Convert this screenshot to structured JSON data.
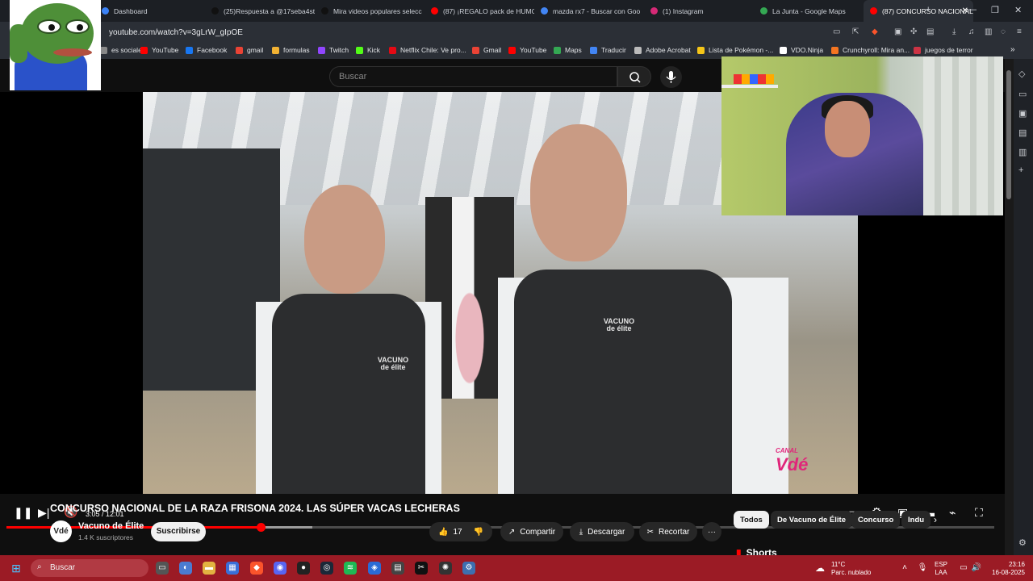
{
  "browser": {
    "tabs": [
      {
        "label": "Dashboard",
        "color": "#3b82f6"
      },
      {
        "label": "(25)Respuesta a @17seba4st",
        "color": "#111111"
      },
      {
        "label": "Mira videos populares selecc",
        "color": "#111111"
      },
      {
        "label": "(87) ¡REGALO pack de HUMO",
        "color": "#ff0000"
      },
      {
        "label": "mazda rx7 - Buscar con Goo",
        "color": "#4285f4"
      },
      {
        "label": "(1) Instagram",
        "color": "#d62976"
      },
      {
        "label": "La Junta - Google Maps",
        "color": "#34a853"
      },
      {
        "label": "(87) CONCURSO NACIONAL",
        "color": "#ff0000",
        "active": true
      }
    ],
    "new_tab": "+",
    "window_controls": {
      "minimize": "—",
      "maximize": "❐",
      "close": "✕"
    },
    "url": "youtube.com/watch?v=3gLrW_gIpOE",
    "bookmarks": [
      {
        "label": "es sociales",
        "color": "#888888"
      },
      {
        "label": "YouTube",
        "color": "#ff0000"
      },
      {
        "label": "Facebook",
        "color": "#1877f2"
      },
      {
        "label": "gmail",
        "color": "#ea4335"
      },
      {
        "label": "formulas",
        "color": "#f2b233"
      },
      {
        "label": "Twitch",
        "color": "#9146ff"
      },
      {
        "label": "Kick",
        "color": "#53fc18"
      },
      {
        "label": "Netflix Chile: Ve pro...",
        "color": "#e50914"
      },
      {
        "label": "Gmail",
        "color": "#ea4335"
      },
      {
        "label": "YouTube",
        "color": "#ff0000"
      },
      {
        "label": "Maps",
        "color": "#34a853"
      },
      {
        "label": "Traducir",
        "color": "#4285f4"
      },
      {
        "label": "Adobe Acrobat",
        "color": "#bbbbbb"
      },
      {
        "label": "Lista de Pokémon -...",
        "color": "#f5c518"
      },
      {
        "label": "VDO.Ninja",
        "color": "#ffffff"
      },
      {
        "label": "Crunchyroll: Mira an...",
        "color": "#f47521"
      },
      {
        "label": "juegos de terror",
        "color": "#cc3344"
      }
    ]
  },
  "youtube": {
    "search_placeholder": "Buscar",
    "player": {
      "time": "3:05 / 12:01",
      "progress": 0.257,
      "buffered": 0.31,
      "watermark_prefix": "CANAL",
      "watermark": "Vdé",
      "vest_logo": "VACUNO\nde élite"
    },
    "video_title": "CONCURSO NACIONAL DE LA RAZA FRISONA 2024. LAS SÚPER VACAS LECHERAS",
    "channel": {
      "avatar": "Vdé",
      "name": "Vacuno de Élite",
      "subscribers": "1.4 K suscriptores"
    },
    "subscribe_label": "Suscribirse",
    "likes": "17",
    "share_label": "Compartir",
    "download_label": "Descargar",
    "clip_label": "Recortar",
    "more_label": "···",
    "chips": [
      "Todos",
      "De Vacuno de Élite",
      "Concurso",
      "Indu"
    ],
    "shorts_label": "Shorts"
  },
  "taskbar": {
    "search_placeholder": "Buscar",
    "weather_temp": "11°C",
    "weather_desc": "Parc. nublado",
    "lang1": "ESP",
    "lang2": "LAA",
    "time": "23:16",
    "date": "16-08-2025"
  }
}
